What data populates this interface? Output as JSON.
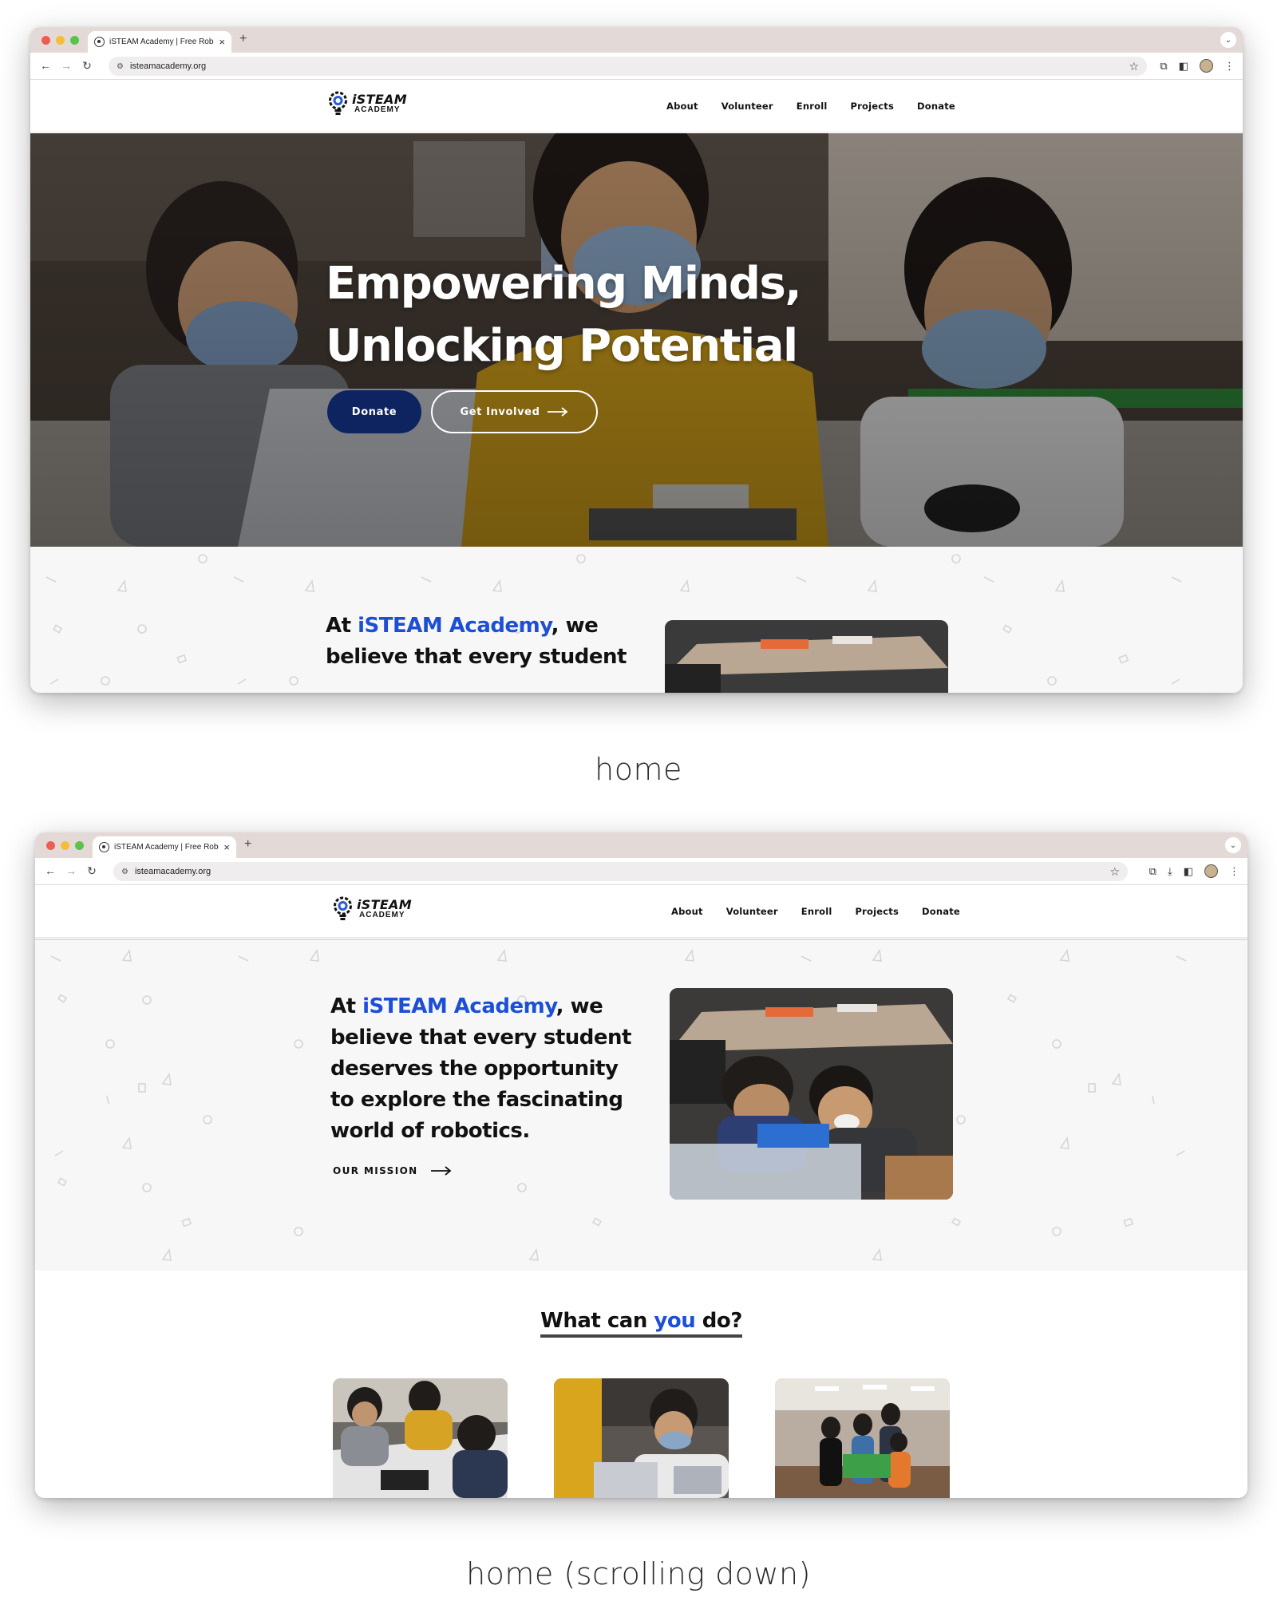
{
  "browser": {
    "tab_title": "iSTEAM Academy | Free Robo",
    "tab_close": "×",
    "new_tab": "+",
    "url": "isteamacademy.org"
  },
  "site": {
    "logo_main": "iSTEAM",
    "logo_sub": "ACADEMY",
    "nav": [
      "About",
      "Volunteer",
      "Enroll",
      "Projects",
      "Donate"
    ]
  },
  "hero": {
    "title_line1": "Empowering Minds,",
    "title_line2": "Unlocking Potential",
    "donate_label": "Donate",
    "involved_label": "Get Involved"
  },
  "mission": {
    "prefix": "At ",
    "brand": "iSTEAM Academy",
    "rest_line1": ", we",
    "line2": "believe that every student",
    "line3": "deserves the opportunity",
    "line4": "to explore the fascinating",
    "line5": "world of robotics.",
    "link_label": "OUR MISSION"
  },
  "what_can_you_do": {
    "before": "What can ",
    "highlight": "you",
    "after": " do?"
  },
  "captions": {
    "first": "home",
    "second": "home (scrolling down)"
  },
  "colors": {
    "brand_blue": "#1d4fd6",
    "navy_button": "#0d2460",
    "tab_bar": "#e3dad7",
    "section_bg": "#f7f7f7"
  }
}
